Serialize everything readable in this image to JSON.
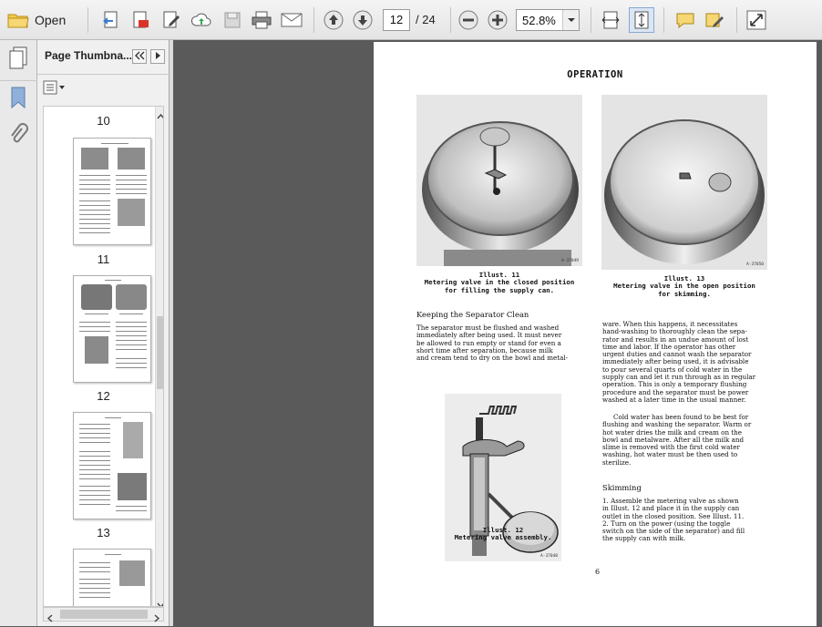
{
  "toolbar": {
    "open_label": "Open",
    "current_page": "12",
    "page_total": "/ 24",
    "zoom": "52.8%"
  },
  "panel": {
    "title": "Page Thumbna...",
    "thumbnails": [
      {
        "label": "10"
      },
      {
        "label": "11"
      },
      {
        "label": "12"
      },
      {
        "label": "13"
      }
    ]
  },
  "document": {
    "title": "OPERATION",
    "caption_11": "Illust. 11\nMetering valve in the closed position\nfor filling the supply can.",
    "caption_13": "Illust. 13\nMetering valve in the open position\nfor skimming.",
    "caption_12": "Illust. 12\nMetering valve assembly.",
    "img_code_11": "A-37049",
    "img_code_13": "A-37050",
    "img_code_12": "A-37048",
    "heading_keeping": "Keeping the Separator Clean",
    "para_left": "The separator must be flushed and washed\nimmediately after being used.  It must never\nbe allowed to run empty or stand for even a\nshort time after separation, because milk\nand cream tend to dry on the bowl and metal-",
    "para_right_1": "ware.  When this happens, it necessitates\nhand-washing to thoroughly clean the sepa-\nrator and results in an undue amount of lost\ntime and labor.  If the operator has other\nurgent duties and cannot wash the separator\nimmediately after being used, it is advisable\nto pour several quarts of cold water in the\nsupply can and let it run through as in regular\noperation.  This is only a temporary flushing\nprocedure and the separator must be power\nwashed at a later time in the usual manner.",
    "para_right_2": "Cold water has been found to be best for\nflushing and washing the separator.  Warm or\nhot water dries the milk and cream on the\nbowl and metalware.  After all the milk and\nslime is removed with the first cold water\nwashing, hot water must be then used to\nsterilize.",
    "heading_skimming": "Skimming",
    "para_skimming": "1.  Assemble the metering valve as shown\nin Illust. 12  and place it in the supply can\noutlet in the closed position.  See Illust. 11.\n2.  Turn on the power (using the toggle\nswitch on the side of the separator) and fill\nthe supply can with milk.",
    "page_number": "6"
  }
}
